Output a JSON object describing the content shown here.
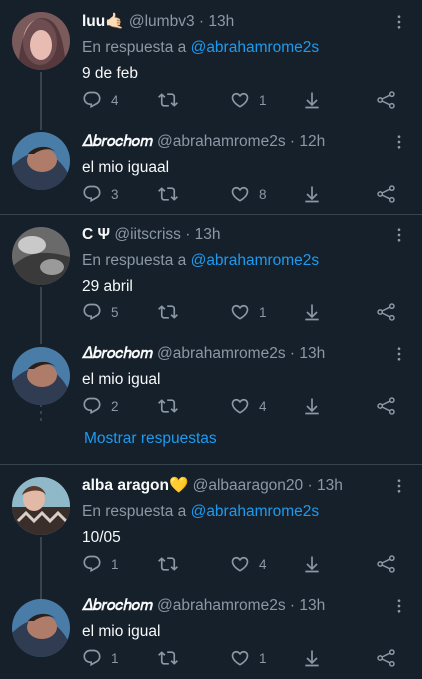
{
  "reply_prefix": "En respuesta a",
  "show_replies": "Mostrar respuestas",
  "tweets": [
    {
      "name": "luu🤙🏻",
      "handle": "@lumbv3",
      "time": "· 13h",
      "reply_to": "@abrahamrome2s",
      "text": "9 de feb",
      "replies": "4",
      "retweets": "",
      "likes": "1"
    },
    {
      "name": "𝛥𝑏𝑟𝑜𝑐ℎ𝑜𝑚",
      "handle": "@abrahamrome2s",
      "time": "· 12h",
      "reply_to": "",
      "text": "el mio iguaal",
      "replies": "3",
      "retweets": "",
      "likes": "8"
    },
    {
      "name": "C Ψ",
      "handle": "@iitscriss",
      "time": "· 13h",
      "reply_to": "@abrahamrome2s",
      "text": "29 abril",
      "replies": "5",
      "retweets": "",
      "likes": "1"
    },
    {
      "name": "𝛥𝑏𝑟𝑜𝑐ℎ𝑜𝑚",
      "handle": "@abrahamrome2s",
      "time": "· 13h",
      "reply_to": "",
      "text": "el mio igual",
      "replies": "2",
      "retweets": "",
      "likes": "4"
    },
    {
      "name": "alba aragon💛",
      "handle": "@albaaragon20",
      "time": "· 13h",
      "reply_to": "@abrahamrome2s",
      "text": "10/05",
      "replies": "1",
      "retweets": "",
      "likes": "4"
    },
    {
      "name": "𝛥𝑏𝑟𝑜𝑐ℎ𝑜𝑚",
      "handle": "@abrahamrome2s",
      "time": "· 13h",
      "reply_to": "",
      "text": "el mio igual",
      "replies": "1",
      "retweets": "",
      "likes": "1"
    }
  ],
  "colors": {
    "background": "#15202b",
    "accent": "#1d9bf0",
    "muted": "#8b98a5",
    "text": "#f7f9f9",
    "divider": "#38444d"
  }
}
